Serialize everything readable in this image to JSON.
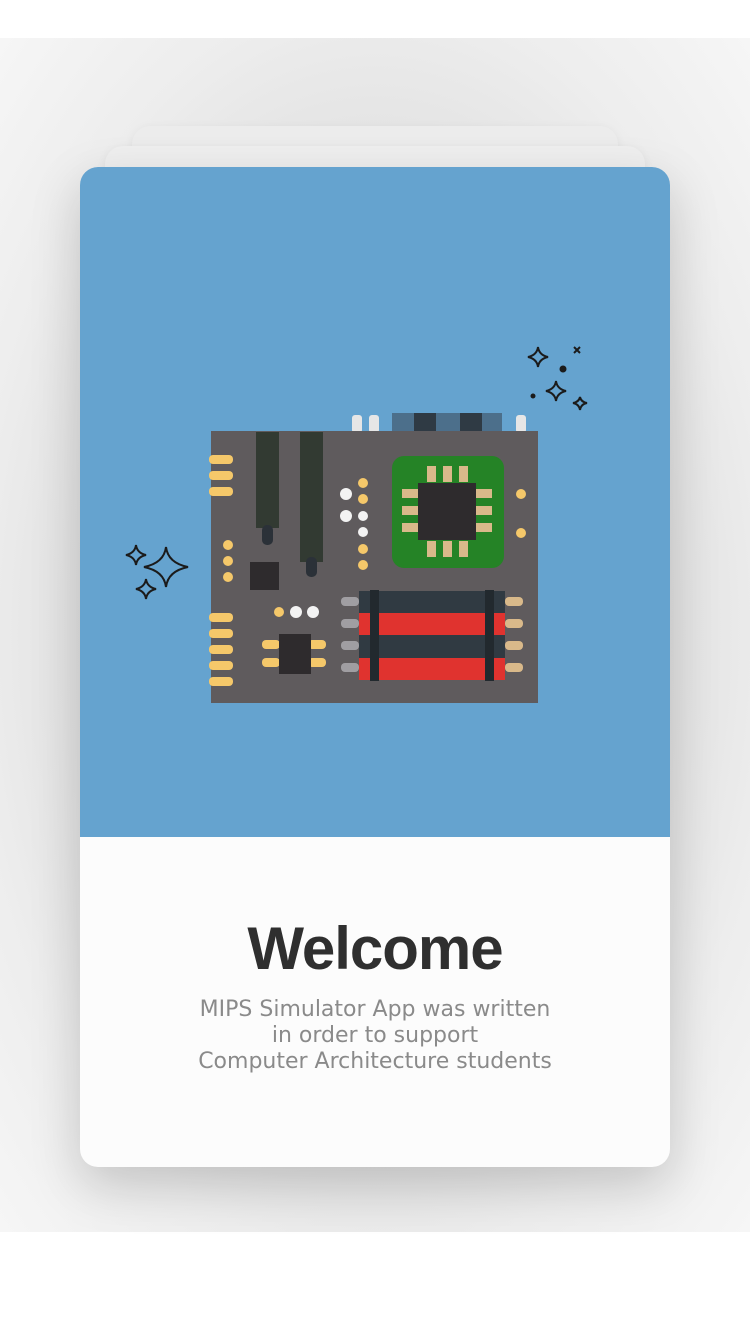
{
  "welcome": {
    "title": "Welcome",
    "description_lines": [
      "MIPS Simulator App was written",
      "in order to support",
      "Computer Architecture students"
    ]
  },
  "illustration": {
    "subject": "motherboard-illustration",
    "colors": {
      "hero_background": "#65a3cf",
      "board": "#5f5b5d",
      "chip_pad": "#258326",
      "memory_red": "#e0332f",
      "connector_gold": "#f5c86a"
    }
  }
}
